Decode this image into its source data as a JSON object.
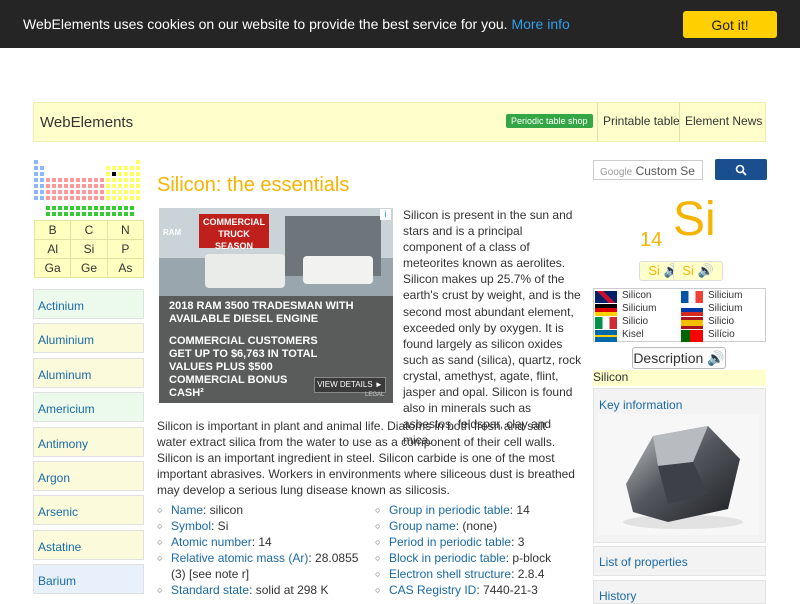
{
  "cookie": {
    "text": "WebElements uses cookies on our website to provide the best service for you.",
    "more": "More info",
    "button": "Got it!"
  },
  "header": {
    "brand": "WebElements",
    "shop": "Periodic table shop",
    "nav": [
      "Printable table",
      "Element News"
    ]
  },
  "mini_table": [
    "B",
    "C",
    "N",
    "Al",
    "Si",
    "P",
    "Ga",
    "Ge",
    "As"
  ],
  "element_list": [
    {
      "label": "Actinium",
      "bg": "#ebfaeb"
    },
    {
      "label": "Aluminium",
      "bg": "#fbfbdb"
    },
    {
      "label": "Aluminum",
      "bg": "#fbfbdb"
    },
    {
      "label": "Americium",
      "bg": "#ebfaeb"
    },
    {
      "label": "Antimony",
      "bg": "#fbfbdb"
    },
    {
      "label": "Argon",
      "bg": "#fbfbdb"
    },
    {
      "label": "Arsenic",
      "bg": "#fbfbdb"
    },
    {
      "label": "Astatine",
      "bg": "#fbfbdb"
    },
    {
      "label": "Barium",
      "bg": "#e8f1fb"
    }
  ],
  "main": {
    "title": "Silicon: the essentials",
    "intro": "Silicon is present in the sun and stars and is a principal component of a class of meteorites known as aerolites. Silicon makes up 25.7% of the earth's crust by weight, and is the second most abundant element, exceeded only by oxygen. It is found largely as silicon oxides such as sand (silica), quartz, rock crystal, amethyst, agate, flint, jasper and opal. Silicon is found also in minerals such as asbestos, feldspar, clay and mica.",
    "para2": "Silicon is important in plant and animal life. Diatoms in both fresh and salt water extract silica from the water to use as a component of their cell walls. Silicon is an important ingredient in steel. Silicon carbide is one of the most important abrasives. Workers in environments where siliceous dust is breathed may develop a serious lung disease known as silicosis."
  },
  "ad": {
    "brand_line1": "COMMERCIAL",
    "brand_line2": "TRUCK SEASON",
    "ram": "RAM",
    "headline": "2018 RAM 3500 TRADESMAN WITH AVAILABLE DIESEL ENGINE",
    "body": "COMMERCIAL CUSTOMERS GET UP TO $6,763 IN TOTAL VALUES PLUS $500 COMMERCIAL BONUS CASH²",
    "cta": "VIEW DETAILS ►",
    "legal": "LEGAL",
    "info": "i"
  },
  "props_left": [
    {
      "k": "Name",
      "v": ": silicon"
    },
    {
      "k": "Symbol",
      "v": ": Si"
    },
    {
      "k": "Atomic number",
      "v": ": 14"
    },
    {
      "k": "Relative atomic mass (Ar)",
      "v": ": 28.0855 (3) [see note r]"
    },
    {
      "k": "Standard state",
      "v": ": solid at 298 K"
    }
  ],
  "props_right": [
    {
      "k": "Group in periodic table",
      "v": ": 14"
    },
    {
      "k": "Group name",
      "v": ": (none)"
    },
    {
      "k": "Period in periodic table",
      "v": ": 3"
    },
    {
      "k": "Block in periodic table",
      "v": ": p-block"
    },
    {
      "k": "Electron shell structure",
      "v": ": 2.8.4"
    },
    {
      "k": "CAS Registry ID",
      "v": ": 7440-21-3"
    }
  ],
  "right": {
    "search_brand": "Google",
    "search_placeholder": "Custom Se",
    "atomic_number": "14",
    "symbol": "Si",
    "speak1": "Si 🔊",
    "speak2": "Si 🔊",
    "languages": [
      {
        "name": "Silicon"
      },
      {
        "name": "Silicium"
      },
      {
        "name": "Silicium"
      },
      {
        "name": "Silicium"
      },
      {
        "name": "Silicio"
      },
      {
        "name": "Silicio"
      },
      {
        "name": "Kisel"
      },
      {
        "name": "Silício"
      }
    ],
    "description": "Description 🔊",
    "element_name": "Silicon",
    "key_info": "Key information",
    "list_props": "List of properties",
    "history": "History"
  }
}
